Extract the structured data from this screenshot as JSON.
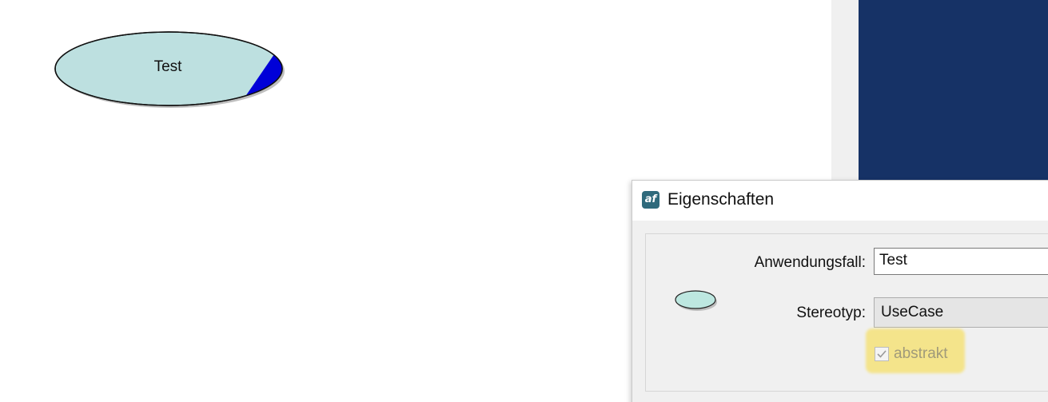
{
  "diagram": {
    "usecase_label": "Test",
    "usecase_fill": "#bde0e0",
    "usecase_marker_color": "#0000d8"
  },
  "background": {
    "side_panel_color": "#163266"
  },
  "dialog": {
    "title": "Eigenschaften",
    "icon_text": "af",
    "fields": {
      "usecase_label": "Anwendungsfall:",
      "usecase_value": "Test",
      "stereotype_label": "Stereotyp:",
      "stereotype_value": "UseCase",
      "abstract_label": "abstrakt",
      "abstract_checked": true
    }
  }
}
